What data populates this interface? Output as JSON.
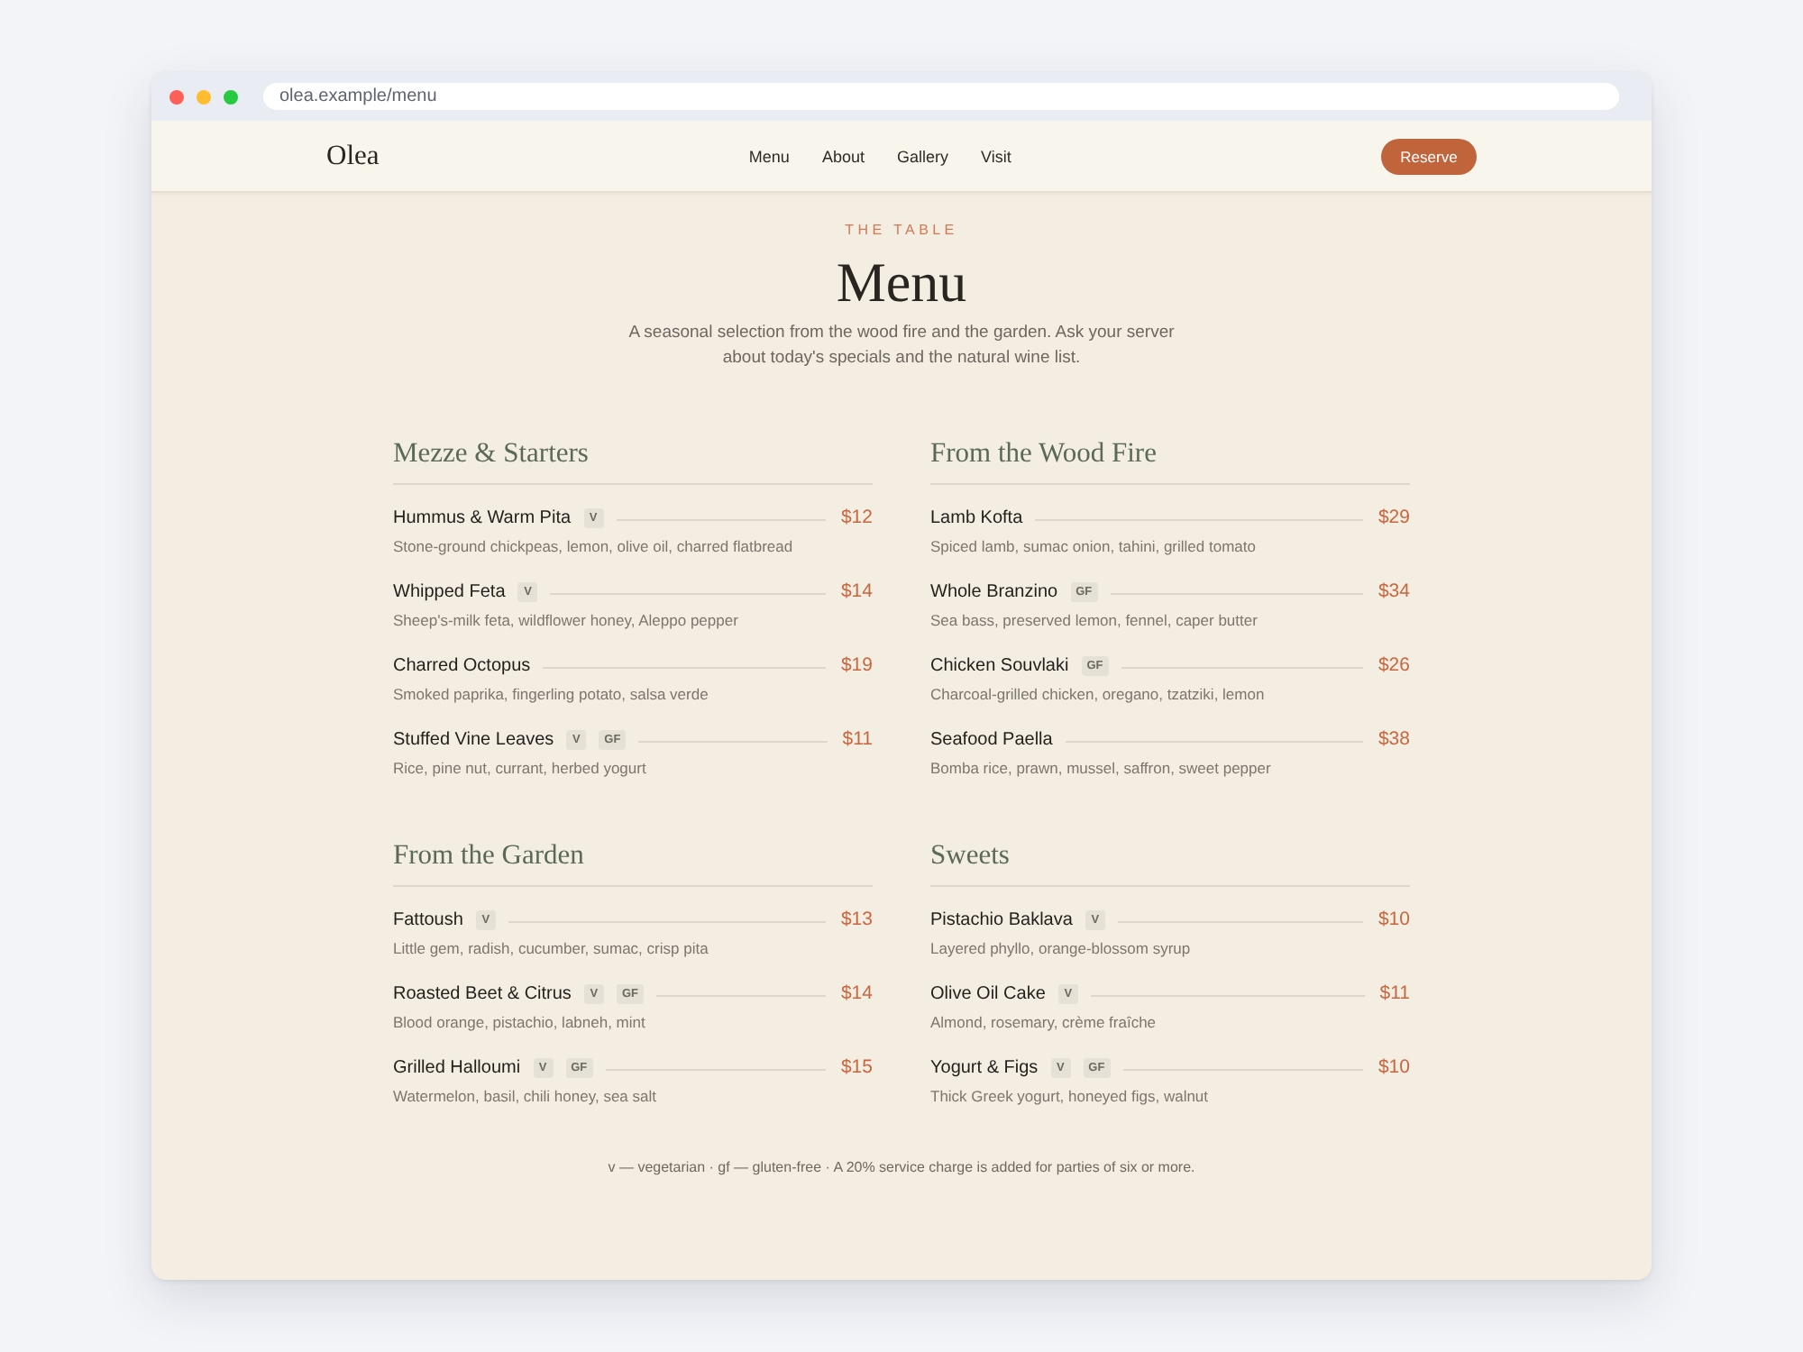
{
  "browser": {
    "url": "olea.example/menu"
  },
  "nav": {
    "logo": "Olea",
    "links": [
      {
        "label": "Menu"
      },
      {
        "label": "About"
      },
      {
        "label": "Gallery"
      },
      {
        "label": "Visit"
      }
    ],
    "cta": "Reserve"
  },
  "hero": {
    "eyebrow": "THE TABLE",
    "title": "Menu",
    "intro": "A seasonal selection from the wood fire and the garden. Ask your server about today's specials and the natural wine list."
  },
  "sections": [
    {
      "title": "Mezze & Starters",
      "items": [
        {
          "name": "Hummus & Warm Pita",
          "tags": [
            "V"
          ],
          "price": "$12",
          "description": "Stone-ground chickpeas, lemon, olive oil, charred flatbread"
        },
        {
          "name": "Whipped Feta",
          "tags": [
            "V"
          ],
          "price": "$14",
          "description": "Sheep's-milk feta, wildflower honey, Aleppo pepper"
        },
        {
          "name": "Charred Octopus",
          "price": "$19",
          "description": "Smoked paprika, fingerling potato, salsa verde"
        },
        {
          "name": "Stuffed Vine Leaves",
          "tags": [
            "V",
            "GF"
          ],
          "price": "$11",
          "description": "Rice, pine nut, currant, herbed yogurt"
        }
      ]
    },
    {
      "title": "From the Wood Fire",
      "items": [
        {
          "name": "Lamb Kofta",
          "price": "$29",
          "description": "Spiced lamb, sumac onion, tahini, grilled tomato"
        },
        {
          "name": "Whole Branzino",
          "tags": [
            "GF"
          ],
          "price": "$34",
          "description": "Sea bass, preserved lemon, fennel, caper butter"
        },
        {
          "name": "Chicken Souvlaki",
          "tags": [
            "GF"
          ],
          "price": "$26",
          "description": "Charcoal-grilled chicken, oregano, tzatziki, lemon"
        },
        {
          "name": "Seafood Paella",
          "price": "$38",
          "description": "Bomba rice, prawn, mussel, saffron, sweet pepper"
        }
      ]
    },
    {
      "title": "From the Garden",
      "items": [
        {
          "name": "Fattoush",
          "tags": [
            "V"
          ],
          "price": "$13",
          "description": "Little gem, radish, cucumber, sumac, crisp pita"
        },
        {
          "name": "Roasted Beet & Citrus",
          "tags": [
            "V",
            "GF"
          ],
          "price": "$14",
          "description": "Blood orange, pistachio, labneh, mint"
        },
        {
          "name": "Grilled Halloumi",
          "tags": [
            "V",
            "GF"
          ],
          "price": "$15",
          "description": "Watermelon, basil, chili honey, sea salt"
        }
      ]
    },
    {
      "title": "Sweets",
      "items": [
        {
          "name": "Pistachio Baklava",
          "tags": [
            "V"
          ],
          "price": "$10",
          "description": "Layered phyllo, orange-blossom syrup"
        },
        {
          "name": "Olive Oil Cake",
          "tags": [
            "V"
          ],
          "price": "$11",
          "description": "Almond, rosemary, crème fraîche"
        },
        {
          "name": "Yogurt & Figs",
          "tags": [
            "V",
            "GF"
          ],
          "price": "$10",
          "description": "Thick Greek yogurt, honeyed figs, walnut"
        }
      ]
    }
  ],
  "footnote": "v — vegetarian · gf — gluten-free · A 20% service charge is added for parties of six or more."
}
